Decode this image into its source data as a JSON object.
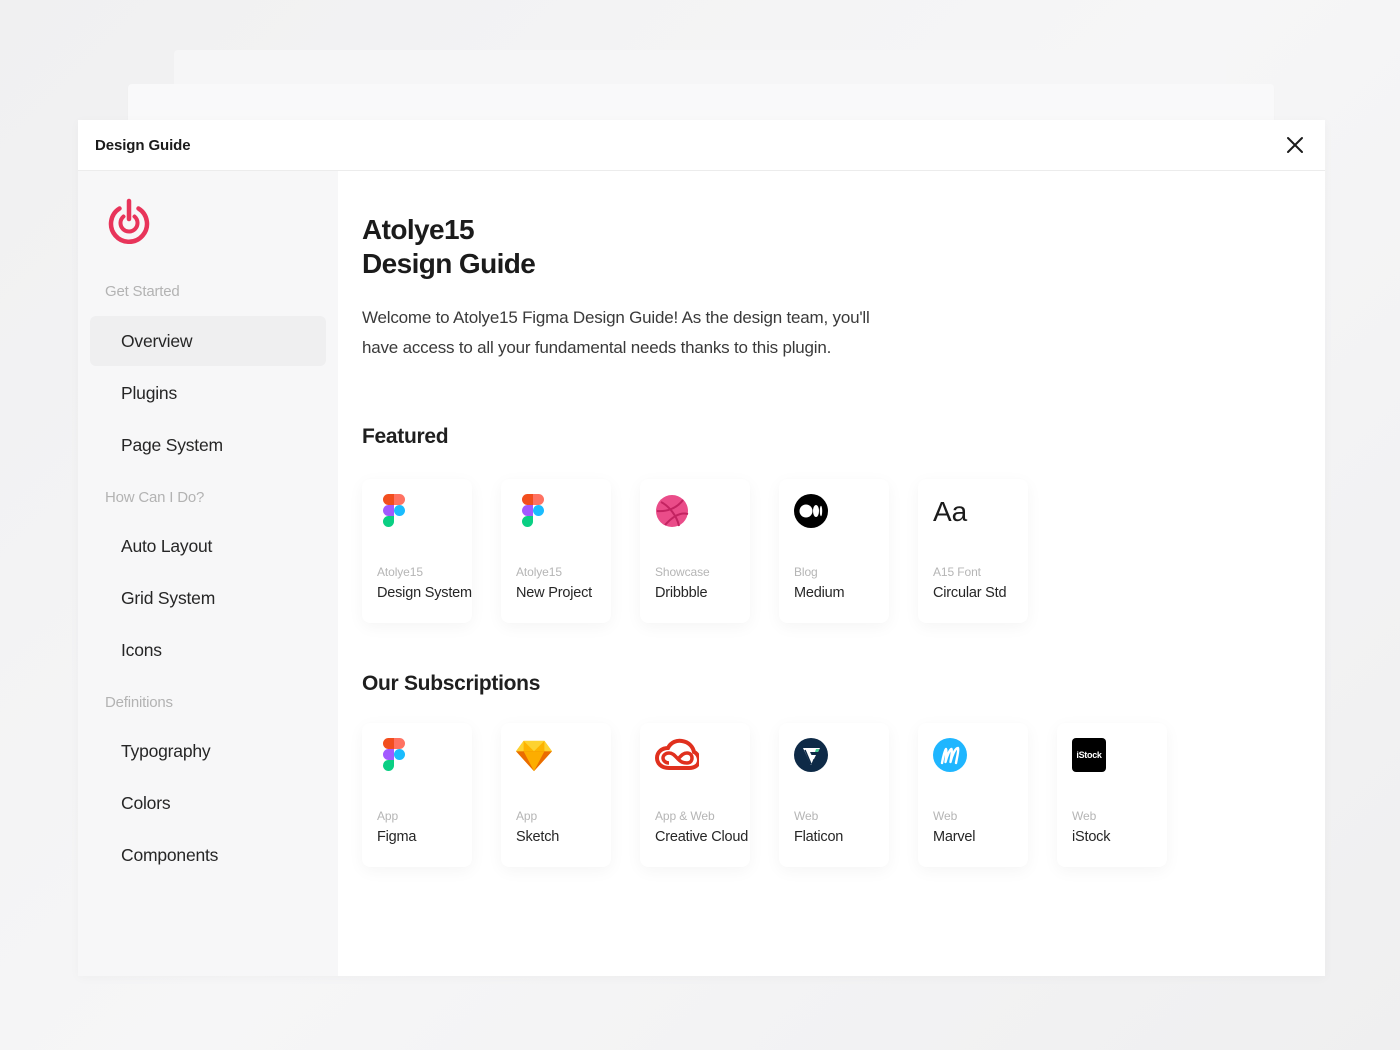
{
  "window": {
    "title": "Design Guide"
  },
  "colors": {
    "brand": "#e8345a",
    "active_bg": "#efeff0",
    "sidebar_bg": "#f7f7f8"
  },
  "sidebar": {
    "logo_icon": "power-logo",
    "sections": [
      {
        "label": "Get Started",
        "items": [
          "Overview",
          "Plugins",
          "Page System"
        ]
      },
      {
        "label": "How Can I Do?",
        "items": [
          "Auto Layout",
          "Grid System",
          "Icons"
        ]
      },
      {
        "label": "Definitions",
        "items": [
          "Typography",
          "Colors",
          "Components"
        ]
      }
    ],
    "active_item": "Overview"
  },
  "main": {
    "heading_line1": "Atolye15",
    "heading_line2": "Design Guide",
    "intro": "Welcome to Atolye15 Figma Design Guide! As the design team, you'll have access to all your fundamental needs thanks to this plugin.",
    "featured": {
      "title": "Featured",
      "cards": [
        {
          "icon": "figma-icon",
          "sub": "Atolye15",
          "name": "Design System"
        },
        {
          "icon": "figma-icon",
          "sub": "Atolye15",
          "name": "New Project"
        },
        {
          "icon": "dribbble-icon",
          "sub": "Showcase",
          "name": "Dribbble"
        },
        {
          "icon": "medium-icon",
          "sub": "Blog",
          "name": "Medium"
        },
        {
          "icon": "font-aa-icon",
          "icon_text": "Aa",
          "sub": "A15 Font",
          "name": "Circular Std"
        }
      ]
    },
    "subscriptions": {
      "title": "Our Subscriptions",
      "cards": [
        {
          "icon": "figma-icon",
          "sub": "App",
          "name": "Figma"
        },
        {
          "icon": "sketch-icon",
          "sub": "App",
          "name": "Sketch"
        },
        {
          "icon": "creative-cloud-icon",
          "sub": "App & Web",
          "name": "Creative Cloud"
        },
        {
          "icon": "flaticon-icon",
          "sub": "Web",
          "name": "Flaticon"
        },
        {
          "icon": "marvel-icon",
          "sub": "Web",
          "name": "Marvel"
        },
        {
          "icon": "istock-icon",
          "icon_text": "iStock",
          "sub": "Web",
          "name": "iStock"
        }
      ]
    }
  }
}
